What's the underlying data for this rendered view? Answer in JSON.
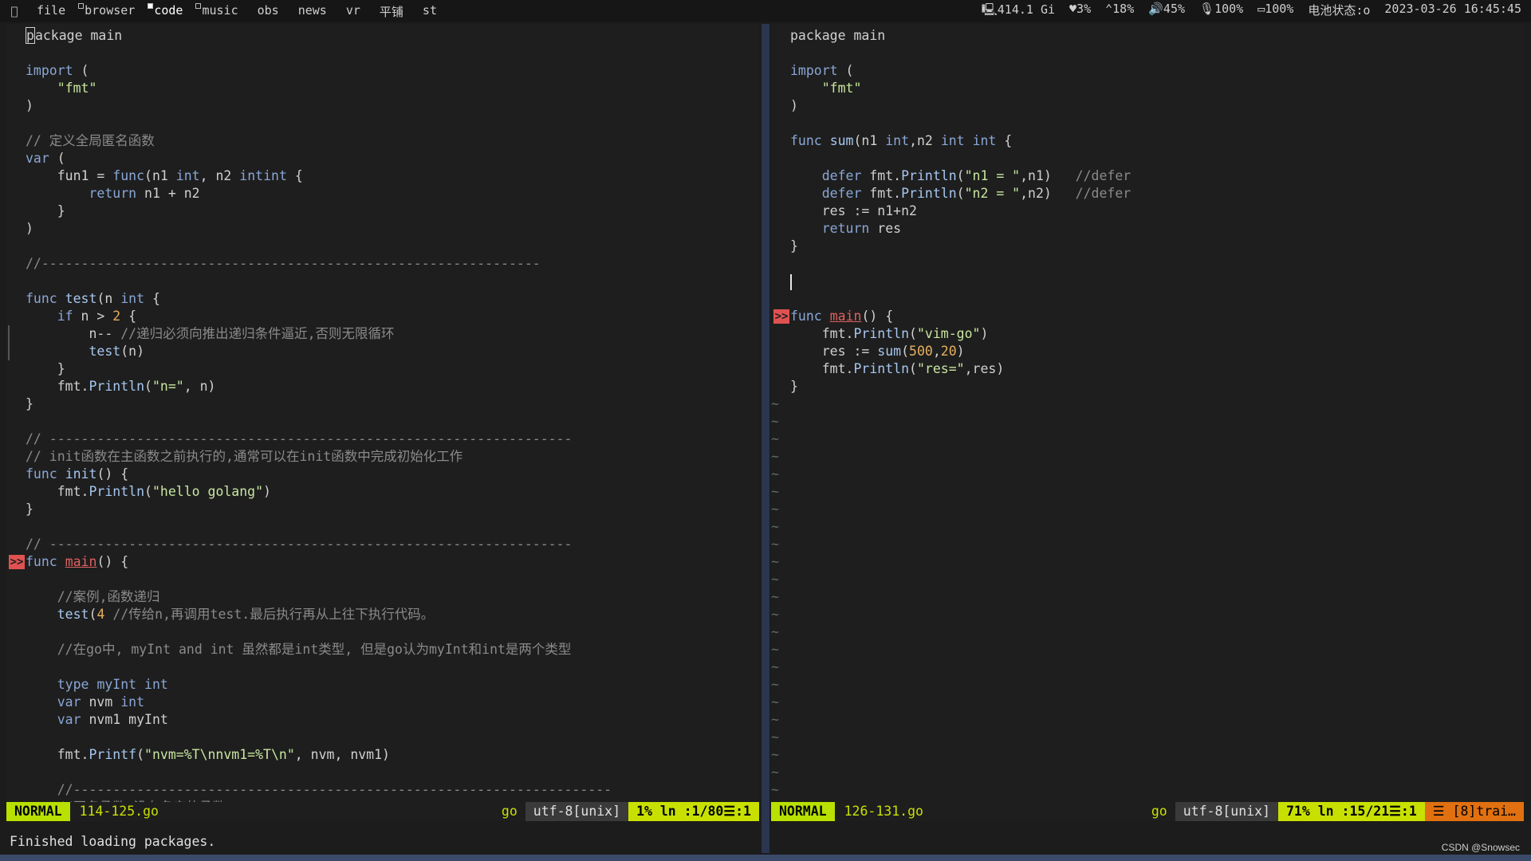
{
  "topbar": {
    "tags": [
      {
        "label": "file",
        "marker": false,
        "active": false
      },
      {
        "label": "browser",
        "marker": true,
        "active": false
      },
      {
        "label": "code",
        "marker": true,
        "active": true
      },
      {
        "label": "music",
        "marker": true,
        "active": false
      },
      {
        "label": "obs",
        "marker": false,
        "active": false
      },
      {
        "label": "news",
        "marker": false,
        "active": false
      },
      {
        "label": "vr",
        "marker": false,
        "active": false
      },
      {
        "label": "平铺",
        "marker": false,
        "active": false
      },
      {
        "label": "st",
        "marker": false,
        "active": false
      }
    ],
    "status": {
      "disk": "414.1 Gi",
      "cpu": "3%",
      "temp": "18%",
      "volume": "45%",
      "mic": "100%",
      "battery": "100%",
      "battery_state": "电池状态:o",
      "datetime": "2023-03-26 16:45:45"
    }
  },
  "left": {
    "lines": [
      [
        [
          "cursor",
          "p"
        ],
        [
          "",
          "ackage main"
        ]
      ],
      [],
      [
        [
          "kw",
          "import"
        ],
        [
          "",
          " ("
        ]
      ],
      [
        [
          "",
          "    "
        ],
        [
          "str",
          "\"fmt\""
        ]
      ],
      [
        [
          "",
          ")"
        ]
      ],
      [],
      [
        [
          "cm",
          "// 定义全局匿名函数"
        ]
      ],
      [
        [
          "kw",
          "var"
        ],
        [
          "",
          " ("
        ]
      ],
      [
        [
          "",
          "    fun1 = "
        ],
        [
          "kw",
          "func"
        ],
        [
          "",
          "(n1 "
        ],
        [
          "ty",
          "int"
        ],
        [
          "",
          ", n2 "
        ],
        [
          "ty",
          "int"
        ],
        [
          ") "
        ],
        [
          "ty",
          "int"
        ],
        [
          "",
          " {"
        ]
      ],
      [
        [
          "",
          "        "
        ],
        [
          "kw",
          "return"
        ],
        [
          "",
          " n1 + n2"
        ]
      ],
      [
        [
          "",
          "    }"
        ]
      ],
      [
        [
          "",
          ")"
        ]
      ],
      [],
      [
        [
          "cm",
          "//---------------------------------------------------------------"
        ]
      ],
      [],
      [
        [
          "kw",
          "func"
        ],
        [
          "",
          " "
        ],
        [
          "fn",
          "test"
        ],
        [
          "",
          "(n "
        ],
        [
          "ty",
          "int"
        ],
        [
          "",
          " {"
        ]
      ],
      [
        [
          "",
          "    "
        ],
        [
          "kw",
          "if"
        ],
        [
          "",
          " n > "
        ],
        [
          "num",
          "2"
        ],
        [
          "",
          " {"
        ]
      ],
      [
        [
          "",
          "        n-- "
        ],
        [
          "cm",
          "//递归必须向推出递归条件逼近,否则无限循环"
        ]
      ],
      [
        [
          "",
          "        "
        ],
        [
          "fn",
          "test"
        ],
        [
          "",
          "(n)"
        ]
      ],
      [
        [
          "",
          "    }"
        ]
      ],
      [
        [
          "",
          "    fmt."
        ],
        [
          "fn",
          "Println"
        ],
        [
          "",
          "("
        ],
        [
          "str",
          "\"n=\""
        ],
        [
          "",
          ", n)"
        ]
      ],
      [
        [
          "",
          "}"
        ]
      ],
      [],
      [
        [
          "cm",
          "// ------------------------------------------------------------------"
        ]
      ],
      [
        [
          "cm",
          "// init函数在主函数之前执行的,通常可以在init函数中完成初始化工作"
        ]
      ],
      [
        [
          "kw",
          "func"
        ],
        [
          "",
          " "
        ],
        [
          "fn",
          "init"
        ],
        [
          "",
          "() {"
        ]
      ],
      [
        [
          "",
          "    fmt."
        ],
        [
          "fn",
          "Println"
        ],
        [
          "",
          "("
        ],
        [
          "str",
          "\"hello golang\""
        ],
        [
          "",
          ")"
        ]
      ],
      [
        [
          "",
          "}"
        ]
      ],
      [],
      [
        [
          "cm",
          "// ------------------------------------------------------------------"
        ]
      ],
      [
        [
          "kw",
          "func"
        ],
        [
          "",
          " "
        ],
        [
          "err",
          "main"
        ],
        [
          "",
          "() {"
        ]
      ],
      [],
      [
        [
          "",
          "    "
        ],
        [
          "cm",
          "//案例,函数递归"
        ]
      ],
      [
        [
          "",
          "    "
        ],
        [
          "fn",
          "test"
        ],
        [
          "",
          "("
        ],
        [
          "num",
          "4"
        ],
        [
          "",
          " "
        ],
        [
          "cm",
          "//传给n,再调用test.最后执行再从上往下执行代码。"
        ]
      ],
      [],
      [
        [
          "",
          "    "
        ],
        [
          "cm",
          "//在go中, myInt and int 虽然都是int类型, 但是go认为myInt和int是两个类型"
        ]
      ],
      [],
      [
        [
          "",
          "    "
        ],
        [
          "kw",
          "type"
        ],
        [
          "",
          " "
        ],
        [
          "ty",
          "myInt"
        ],
        [
          "",
          " "
        ],
        [
          "ty",
          "int"
        ]
      ],
      [
        [
          "",
          "    "
        ],
        [
          "kw",
          "var"
        ],
        [
          "",
          " nvm "
        ],
        [
          "ty",
          "int"
        ]
      ],
      [
        [
          "",
          "    "
        ],
        [
          "kw",
          "var"
        ],
        [
          "",
          " nvm1 myInt"
        ]
      ],
      [],
      [
        [
          "",
          "    fmt."
        ],
        [
          "fn",
          "Printf"
        ],
        [
          "",
          "("
        ],
        [
          "str",
          "\"nvm=%T\\nnvm1=%T\\n\""
        ],
        [
          "",
          ", nvm, nvm1)"
        ]
      ],
      [],
      [
        [
          "cm",
          "    //--------------------------------------------------------------------"
        ]
      ],
      [
        [
          "cm",
          "    //匿名函数,没有名字的函数。"
        ]
      ]
    ],
    "statusline": {
      "mode": "NORMAL",
      "filename": "114-125.go",
      "filetype": "go",
      "encoding": "utf-8[unix]",
      "position": "1%  ln :1/80☰:1"
    }
  },
  "right": {
    "lines": [
      [
        [
          "",
          "package main"
        ]
      ],
      [],
      [
        [
          "kw",
          "import"
        ],
        [
          "",
          " ("
        ]
      ],
      [
        [
          "",
          "    "
        ],
        [
          "str",
          "\"fmt\""
        ]
      ],
      [
        [
          "",
          ")"
        ]
      ],
      [],
      [
        [
          "kw",
          "func"
        ],
        [
          "",
          " "
        ],
        [
          "fn",
          "sum"
        ],
        [
          "",
          "(n1 "
        ],
        [
          "ty",
          "int"
        ],
        [
          "",
          ",n2 "
        ],
        [
          "ty",
          "int"
        ],
        [
          "",
          " "
        ],
        [
          "ty",
          "int"
        ],
        [
          "",
          " {"
        ]
      ],
      [],
      [
        [
          "",
          "    "
        ],
        [
          "kw",
          "defer"
        ],
        [
          "",
          " fmt."
        ],
        [
          "fn",
          "Println"
        ],
        [
          "",
          "("
        ],
        [
          "str",
          "\"n1 = \""
        ],
        [
          "",
          ",n1)   "
        ],
        [
          "cm",
          "//defer"
        ]
      ],
      [
        [
          "",
          "    "
        ],
        [
          "kw",
          "defer"
        ],
        [
          "",
          " fmt."
        ],
        [
          "fn",
          "Println"
        ],
        [
          "",
          "("
        ],
        [
          "str",
          "\"n2 = \""
        ],
        [
          "",
          ",n2)   "
        ],
        [
          "cm",
          "//defer"
        ]
      ],
      [
        [
          "",
          "    res := n1+n2"
        ]
      ],
      [
        [
          "",
          "    "
        ],
        [
          "kw",
          "return"
        ],
        [
          "",
          " res"
        ]
      ],
      [
        [
          "",
          "}"
        ]
      ],
      [],
      [
        [
          "caret",
          ""
        ]
      ],
      [],
      [
        [
          "kw",
          "func"
        ],
        [
          "",
          " "
        ],
        [
          "err",
          "main"
        ],
        [
          "",
          "() {"
        ]
      ],
      [
        [
          "",
          "    fmt."
        ],
        [
          "fn",
          "Println"
        ],
        [
          "",
          "("
        ],
        [
          "str",
          "\"vim-go\""
        ],
        [
          "",
          ")"
        ]
      ],
      [
        [
          "",
          "    res := "
        ],
        [
          "fn",
          "sum"
        ],
        [
          "",
          "("
        ],
        [
          "num",
          "500"
        ],
        [
          "",
          ","
        ],
        [
          "num",
          "20"
        ],
        [
          "",
          ")"
        ]
      ],
      [
        [
          "",
          "    fmt."
        ],
        [
          "fn",
          "Println"
        ],
        [
          "",
          "("
        ],
        [
          "str",
          "\"res=\""
        ],
        [
          "",
          ",res)"
        ]
      ],
      [
        [
          "",
          "}"
        ]
      ]
    ],
    "tilde_count": 23,
    "statusline": {
      "mode": "NORMAL",
      "filename": "126-131.go",
      "filetype": "go",
      "encoding": "utf-8[unix]",
      "position": "71%  ln :15/21☰:1",
      "warning": "☰ [8]trai…"
    }
  },
  "cmdline": "Finished loading packages.",
  "watermark": "CSDN @Snowsec"
}
